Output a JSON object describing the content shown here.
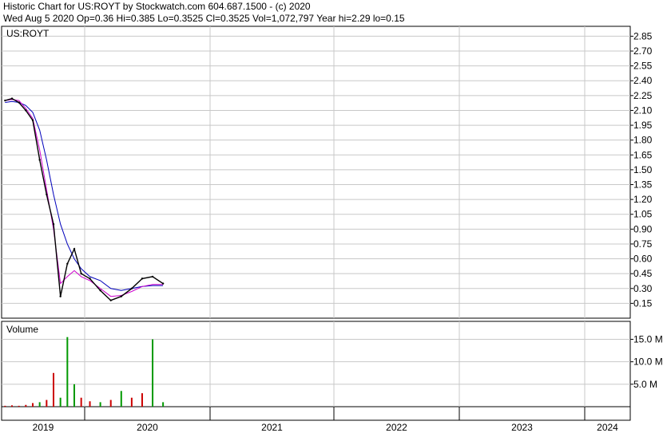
{
  "header": {
    "line1": "Historic Chart for US:ROYT by Stockwatch.com 604.687.1500 - (c) 2020",
    "line2": "Wed Aug  5 2020  Op=0.36  Hi=0.385  Lo=0.3525  Cl=0.3525  Vol=1,072,797  Year hi=2.29  lo=0.15"
  },
  "chart_data": [
    {
      "type": "line",
      "label": "US:ROYT",
      "ylim": [
        0.0,
        2.95
      ],
      "y_ticks": [
        "2.85",
        "2.70",
        "2.55",
        "2.40",
        "2.25",
        "2.10",
        "1.95",
        "1.80",
        "1.65",
        "1.50",
        "1.35",
        "1.20",
        "1.05",
        "0.90",
        "0.75",
        "0.60",
        "0.45",
        "0.30",
        "0.15"
      ],
      "x_ticks": [
        "2019",
        "2020",
        "2021",
        "2022",
        "2023",
        "2024"
      ],
      "x": [
        "2019-01",
        "2019-02",
        "2019-03",
        "2019-04",
        "2019-05",
        "2019-06",
        "2019-07",
        "2019-08",
        "2019-09",
        "2019-10",
        "2019-11",
        "2019-12",
        "2020-01",
        "2020-02",
        "2020-03",
        "2020-04",
        "2020-05",
        "2020-06",
        "2020-07",
        "2020-08"
      ],
      "series": [
        {
          "role": "price",
          "color": "#000000",
          "values": [
            2.2,
            2.22,
            2.18,
            2.1,
            2.0,
            1.6,
            1.25,
            0.95,
            0.22,
            0.55,
            0.7,
            0.45,
            0.4,
            0.28,
            0.18,
            0.22,
            0.3,
            0.4,
            0.42,
            0.35
          ]
        },
        {
          "role": "short-ma",
          "color": "#cc00cc",
          "values": [
            2.2,
            2.21,
            2.2,
            2.12,
            2.02,
            1.7,
            1.3,
            0.9,
            0.35,
            0.42,
            0.48,
            0.42,
            0.38,
            0.3,
            0.22,
            0.23,
            0.27,
            0.32,
            0.34,
            0.34
          ]
        },
        {
          "role": "long-ma",
          "color": "#0000bb",
          "values": [
            2.18,
            2.19,
            2.18,
            2.15,
            2.08,
            1.9,
            1.6,
            1.25,
            0.95,
            0.75,
            0.6,
            0.5,
            0.42,
            0.38,
            0.3,
            0.28,
            0.3,
            0.32,
            0.33,
            0.33
          ]
        }
      ]
    },
    {
      "type": "bar",
      "label": "Volume",
      "ylim": [
        0,
        19.0
      ],
      "y_ticks": [
        "15.0 M",
        "10.0 M",
        "5.0 M"
      ],
      "x": [
        "2019-01",
        "2019-02",
        "2019-03",
        "2019-04",
        "2019-05",
        "2019-06",
        "2019-07",
        "2019-08",
        "2019-09",
        "2019-10",
        "2019-11",
        "2019-12",
        "2020-01",
        "2020-02",
        "2020-03",
        "2020-04",
        "2020-05",
        "2020-06",
        "2020-07",
        "2020-08"
      ],
      "values": [
        0.2,
        0.3,
        0.2,
        0.4,
        0.8,
        1.0,
        1.5,
        7.5,
        2.0,
        15.5,
        5.0,
        2.0,
        1.2,
        1.0,
        1.5,
        3.5,
        2.0,
        3.0,
        15.0,
        1.0
      ],
      "colors": [
        "#cc0000",
        "#cc0000",
        "#cc0000",
        "#cc0000",
        "#cc0000",
        "#009900",
        "#cc0000",
        "#cc0000",
        "#009900",
        "#009900",
        "#009900",
        "#cc0000",
        "#cc0000",
        "#009900",
        "#cc0000",
        "#009900",
        "#cc0000",
        "#cc0000",
        "#009900",
        "#009900"
      ]
    }
  ]
}
